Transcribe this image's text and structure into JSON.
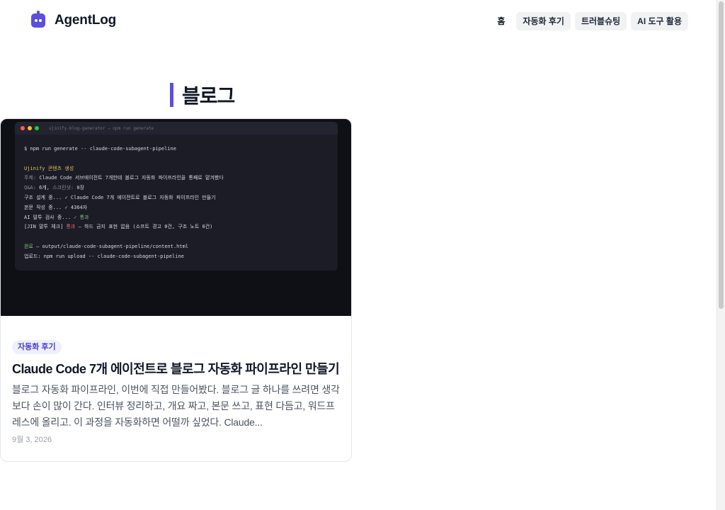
{
  "header": {
    "brand_name": "AgentLog",
    "brand_icon": "robot-icon",
    "nav": {
      "home": "홈",
      "items": [
        "자동화 후기",
        "트러블슈팅",
        "AI 도구 활용"
      ]
    }
  },
  "page": {
    "title": "블로그"
  },
  "post": {
    "tag": "자동화 후기",
    "title": "Claude Code 7개 에이전트로 블로그 자동화 파이프라인 만들기",
    "excerpt": "블로그 자동화 파이프라인, 이번에 직접 만들어봤다. 블로그 글 하나를 쓰려면 생각보다 손이 많이 간다. 인터뷰 정리하고, 개요 짜고, 본문 쓰고, 표현 다듬고, 워드프레스에 올리고. 이 과정을 자동화하면 어떨까 싶었다. Claude...",
    "date": "9월 3, 2026",
    "terminal": {
      "title": "ujinify-blog-generator — npm run generate",
      "command": "$ npm run generate -- claude-code-subagent-pipeline",
      "heading": "Ujinify 콘텐츠 생성",
      "topic_label": "주제:",
      "topic": "Claude Code 서브에이전트 7개한테 블로그 자동화 파이프라인을 통째로 맡겨봤다",
      "qa_label": "Q&A:",
      "qa_value": "6개,",
      "ss_label": "스크린샷:",
      "ss_value": "0장",
      "line_structure": "구조 설계 중... ✓ Claude Code 7개 에이전트로 블로그 자동화 파이프라인 만들기",
      "line_body": "본문 작성 중... ✓ 4364자",
      "line_ai": "AI 말투 검사 중...",
      "line_ai_ok": "✓ 통과",
      "line_jin_a": "[JIN 말투 체크]",
      "line_jin_pass": "통과",
      "line_jin_b": "— 하드 금지 표현 없음 (소프트 경고 0건, 구조 노트 0건)",
      "done_label": "완료",
      "done_path": "— output/claude-code-subagent-pipeline/content.html",
      "upload": "업로드: npm run upload -- claude-code-subagent-pipeline"
    }
  },
  "colors": {
    "accent": "#5b4fe0",
    "tag_bg": "#eef0ff",
    "terminal_bg": "#1b1c26",
    "dot_red": "#ff5f57",
    "dot_yellow": "#febc2e",
    "dot_green": "#28c840"
  }
}
